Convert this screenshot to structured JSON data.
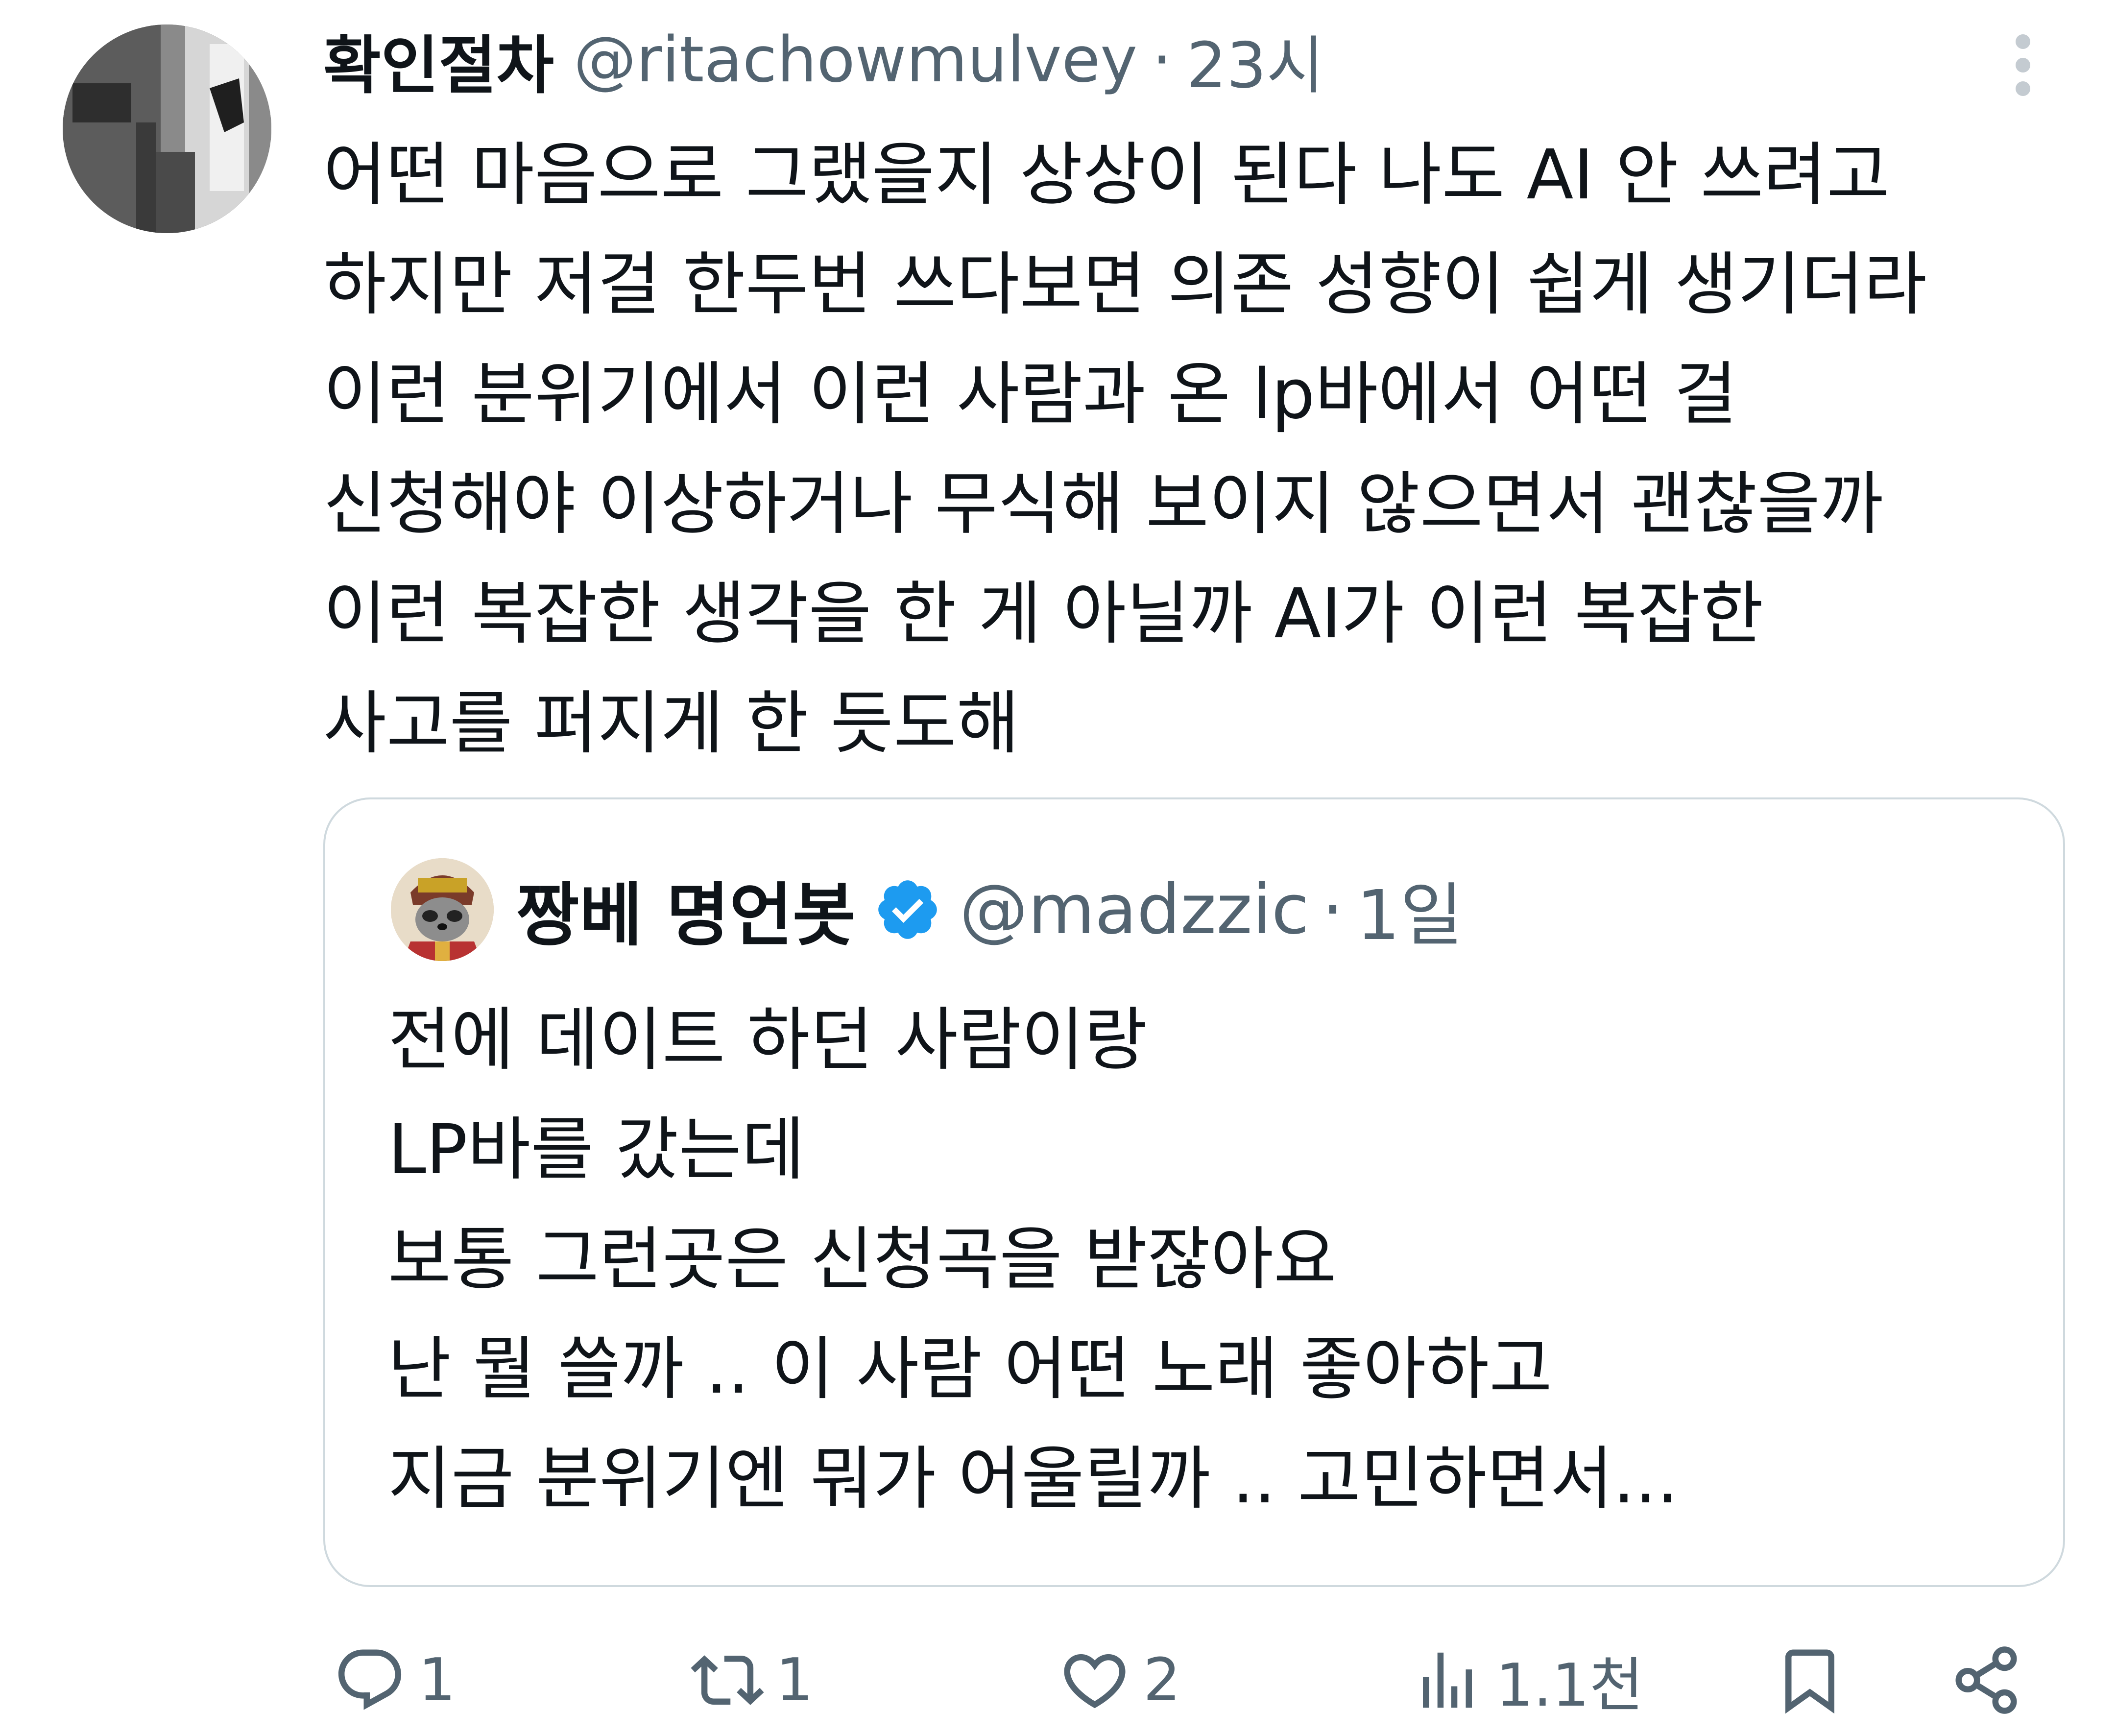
{
  "tweet": {
    "display_name": "확인절차",
    "handle": "@ritachowmulvey",
    "separator": "·",
    "time": "23시",
    "text_lines": [
      "어떤 마음으로 그랬을지 상상이 된다 나도 AI 안 쓰려고",
      "하지만 저걸 한두번 쓰다보면 의존 성향이 쉽게 생기더라",
      "이런 분위기에서 이런 사람과 온 lp바에서 어떤 걸",
      "신청해야 이상하거나 무식해 보이지 않으면서 괜찮을까",
      "이런 복잡한 생각을 한 게 아닐까 AI가 이런 복잡한",
      "사고를 퍼지게 한 듯도해"
    ]
  },
  "quote": {
    "display_name": "짱베 명언봇",
    "handle": "@madzzic",
    "separator": "·",
    "time": "1일",
    "text_lines": [
      "전에 데이트 하던 사람이랑",
      "LP바를 갔는데",
      "보통 그런곳은 신청곡을 받잖아요",
      "난 뭘 쓸까 .. 이 사람 어떤 노래 좋아하고",
      "지금 분위기엔 뭐가 어울릴까 .. 고민하면서..."
    ]
  },
  "actions": {
    "reply_count": "1",
    "retweet_count": "1",
    "like_count": "2",
    "views_count": "1.1천"
  },
  "colors": {
    "text": "#0f1419",
    "secondary": "#536471",
    "border": "#cfd9de",
    "verified": "#1d9bf0"
  }
}
